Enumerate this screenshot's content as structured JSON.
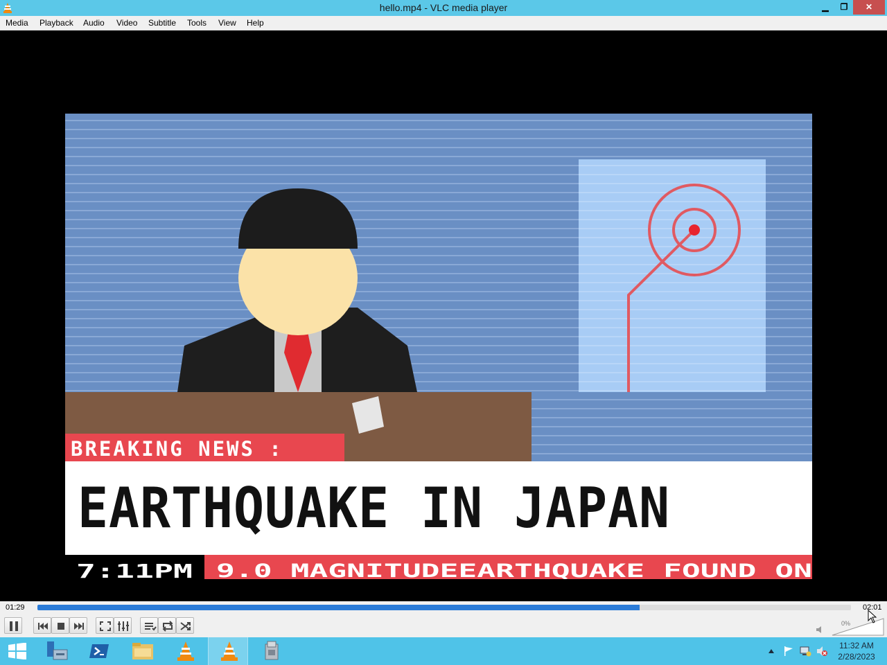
{
  "window": {
    "title": "hello.mp4 - VLC media player",
    "minimize_label": "▁",
    "restore_label": "❐",
    "close_label": "✕"
  },
  "menu": [
    "Media",
    "Playback",
    "Audio",
    "Video",
    "Subtitle",
    "Tools",
    "View",
    "Help"
  ],
  "video": {
    "breaking_label": "BREAKING NEWS :",
    "headline": "EARTHQUAKE IN JAPAN",
    "ticker_time": "7:11PM",
    "ticker_text": "9.0 MAGNITUDEEARTHQUAKE FOUND ON"
  },
  "playback": {
    "elapsed": "01:29",
    "total": "02:01",
    "progress_fraction": 0.74
  },
  "volume": {
    "label": "0%",
    "level_fraction": 0
  },
  "taskbar": {
    "clock_time": "11:32 AM",
    "clock_date": "2/28/2023"
  },
  "icons": {
    "app": "vlc-cone-icon",
    "pause": "pause-icon",
    "previous": "previous-icon",
    "stop": "stop-icon",
    "next": "next-icon",
    "fullscreen": "fullscreen-icon",
    "extended": "extended-settings-icon",
    "playlist": "playlist-icon",
    "loop": "loop-icon",
    "random": "random-icon",
    "volume": "speaker-icon"
  },
  "colors": {
    "titlebar": "#5bc8e8",
    "taskbar": "#4fc3e8",
    "seek_fill": "#2a7bd8",
    "news_red": "#e8474f",
    "studio_blue": "#6a8fc4"
  }
}
